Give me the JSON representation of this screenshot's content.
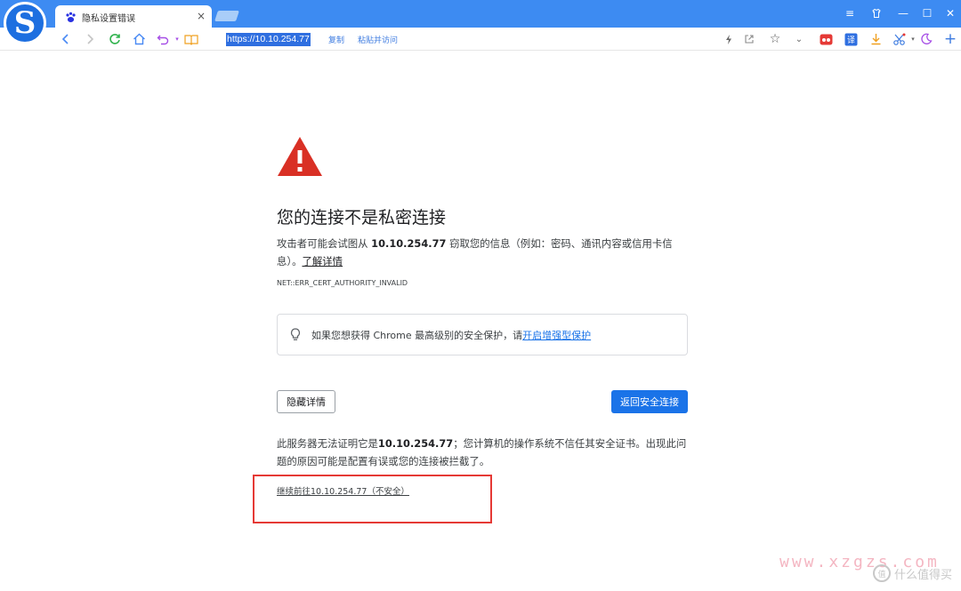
{
  "browser": {
    "logo_letter": "S",
    "tab": {
      "title": "隐私设置错误",
      "close": "×"
    },
    "window_controls": [
      "≡",
      "♡",
      "—",
      "☐",
      "✕"
    ],
    "address": "https://10.10.254.77",
    "copy_label": "复制",
    "paste_go_label": "粘贴并访问",
    "colors": {
      "titlebar": "#3d8bf2",
      "accent": "#1a73e8"
    }
  },
  "page": {
    "title": "您的连接不是私密连接",
    "desc_prefix": "攻击者可能会试图从 ",
    "desc_host": "10.10.254.77",
    "desc_suffix": " 窃取您的信息（例如：密码、通讯内容或信用卡信息）。",
    "learn_more": "了解详情",
    "error_code": "NET::ERR_CERT_AUTHORITY_INVALID",
    "protect_text": "如果您想获得 Chrome 最高级别的安全保护，请",
    "protect_link": "开启增强型保护",
    "hide_details": "隐藏详情",
    "back_to_safety": "返回安全连接",
    "detail_prefix": "此服务器无法证明它是",
    "detail_host": "10.10.254.77",
    "detail_suffix": "；您计算机的操作系统不信任其安全证书。出现此问题的原因可能是配置有误或您的连接被拦截了。",
    "proceed_link": "继续前往10.10.254.77（不安全）"
  },
  "watermark": {
    "url": "www.xzgzs.com",
    "brand": "什么值得买",
    "badge": "值"
  }
}
